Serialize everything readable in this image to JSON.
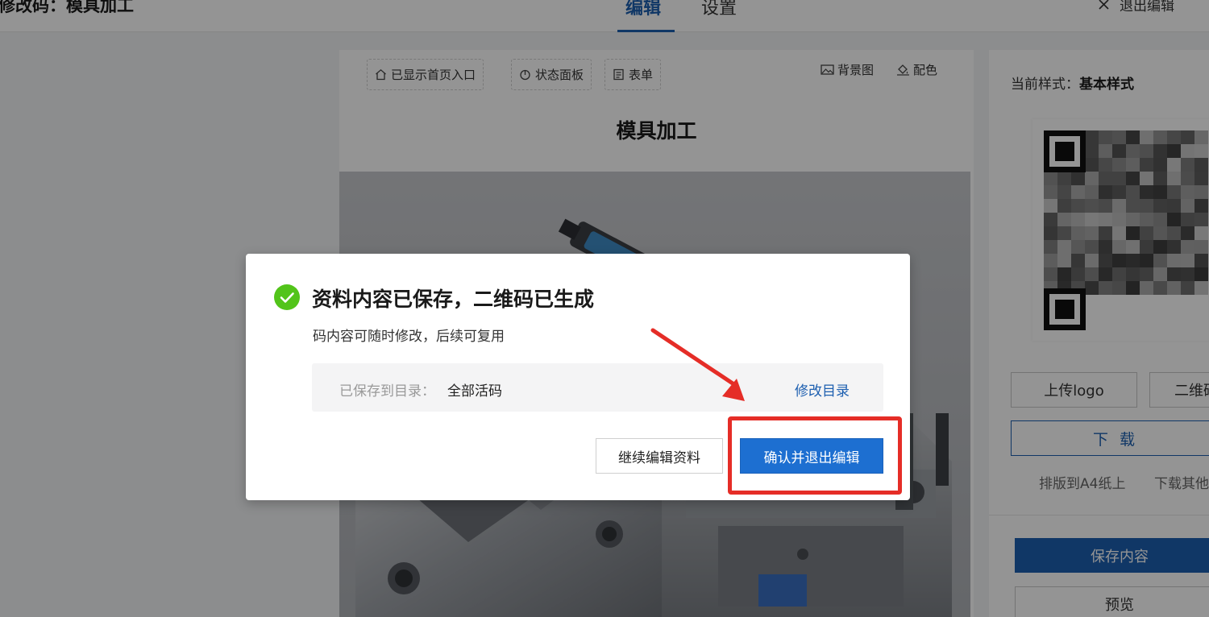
{
  "header": {
    "page_title": "修改码：模具加工",
    "tabs": [
      {
        "label": "编辑",
        "active": true
      },
      {
        "label": "设置",
        "active": false
      }
    ],
    "exit_label": "退出编辑",
    "exit_icon": "close-icon"
  },
  "editor": {
    "chips": [
      {
        "label": "已显示首页入口",
        "icon": "home-icon"
      },
      {
        "label": "状态面板",
        "icon": "power-icon"
      },
      {
        "label": "表单",
        "icon": "form-icon"
      }
    ],
    "tools": [
      {
        "label": "背景图",
        "icon": "image-icon"
      },
      {
        "label": "配色",
        "icon": "paint-bucket-icon"
      }
    ],
    "document_title": "模具加工"
  },
  "right_panel": {
    "style_label": "当前样式：",
    "style_value": "基本样式",
    "upload_logo_label": "上传logo",
    "qr_label_partial": "二维码",
    "download_label": "下 载",
    "a4_label": "排版到A4纸上",
    "download_other_label": "下载其他",
    "save_label": "保存内容",
    "preview_label": "预览"
  },
  "dialog": {
    "title": "资料内容已保存，二维码已生成",
    "description": "码内容可随时修改，后续可复用",
    "dir_label": "已保存到目录：",
    "dir_value": "全部活码",
    "dir_change_label": "修改目录",
    "continue_label": "继续编辑资料",
    "confirm_label": "确认并退出编辑",
    "success_icon": "check-circle-icon"
  },
  "colors": {
    "brand_blue": "#1d5fb0",
    "confirm_blue": "#1d6fd1",
    "success_green": "#52c41a",
    "highlight_red": "#e52d27"
  }
}
